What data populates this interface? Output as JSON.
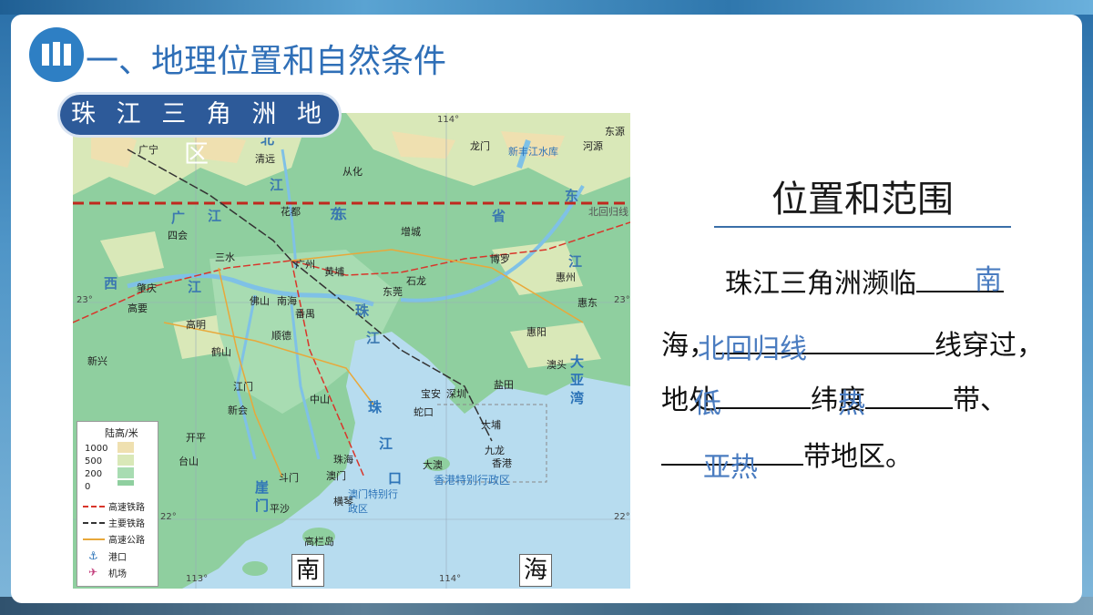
{
  "slide": {
    "section_title": "一、地理位置和自然条件",
    "map_title": "珠 江 三 角 洲 地 区"
  },
  "map": {
    "cities": [
      "广宁",
      "清远",
      "从化",
      "龙门",
      "河源",
      "东源",
      "花都",
      "增城",
      "四会",
      "三水",
      "广州",
      "黄埔",
      "博罗",
      "惠州",
      "肇庆",
      "佛山",
      "南海",
      "东莞",
      "石龙",
      "高要",
      "番禺",
      "惠东",
      "高明",
      "顺德",
      "惠阳",
      "鹤山",
      "新兴",
      "江门",
      "宝安",
      "深圳",
      "盐田",
      "澳头",
      "新会",
      "中山",
      "蛇口",
      "大埔",
      "开平",
      "珠海",
      "九龙",
      "香港",
      "台山",
      "澳门",
      "大澳",
      "斗门",
      "横琴",
      "平沙",
      "高栏岛"
    ],
    "regions": [
      "北",
      "江",
      "东",
      "江",
      "广",
      "东",
      "省",
      "西",
      "江",
      "珠",
      "江",
      "东",
      "江",
      "大",
      "亚",
      "湾",
      "崖",
      "门",
      "珠",
      "江",
      "口"
    ],
    "water_labels": [
      "新丰江水库",
      "北回归线"
    ],
    "special_regions": [
      "香港特别行政区",
      "澳门特别行政区"
    ],
    "coords": [
      "114°",
      "23°",
      "23°",
      "22°",
      "22°",
      "113°",
      "114°"
    ],
    "sea_chars": [
      "南",
      "海"
    ],
    "legend": {
      "title": "陆高/米",
      "elevations": [
        "1000",
        "500",
        "200",
        "0"
      ],
      "items": [
        "高速铁路",
        "主要铁路",
        "高速公路",
        "港口",
        "机场"
      ]
    },
    "colors": {
      "tropic_line": "#c0281e",
      "high_speed_rail": "#d9352a",
      "main_rail": "#333333",
      "expressway": "#e8a83a",
      "sea": "#b7dcef",
      "land_low": "#8fcf9f",
      "land_high": "#efe0b0"
    }
  },
  "panel": {
    "title": "位置和范围",
    "line1": "珠江三角洲濒临",
    "line2_pre": "海，",
    "line2_post": "线穿过，",
    "line3_a": "地处",
    "line3_b": "纬度",
    "line3_c": "带、",
    "line4": "带地区。",
    "answers": {
      "sea": "南",
      "line": "北回归线",
      "latitude": "低",
      "zone": "热",
      "climate": "亚热"
    }
  }
}
